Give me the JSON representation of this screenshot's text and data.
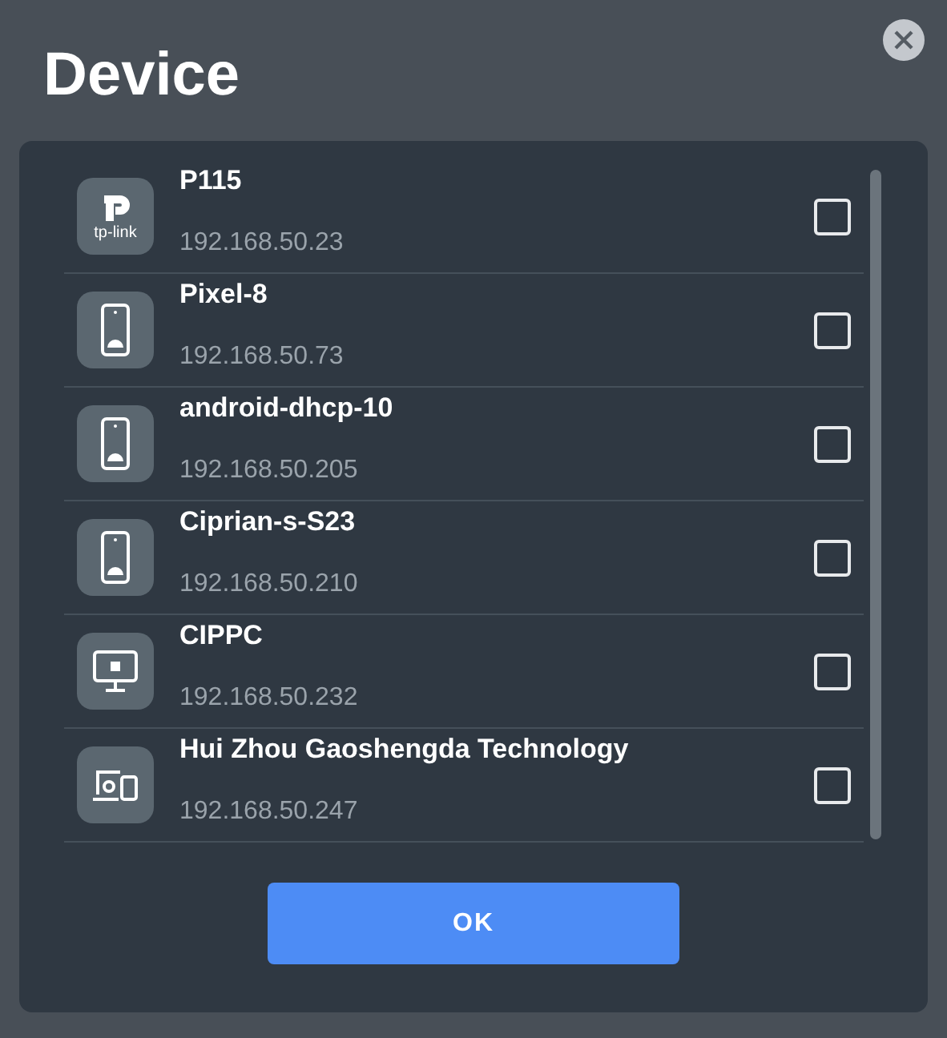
{
  "title": "Device",
  "devices": [
    {
      "kind": "tplink",
      "logo_text": "tp-link",
      "name": "P115",
      "ip": "192.168.50.23",
      "checked": false
    },
    {
      "kind": "phone",
      "name": "Pixel-8",
      "ip": "192.168.50.73",
      "checked": false
    },
    {
      "kind": "phone",
      "name": "android-dhcp-10",
      "ip": "192.168.50.205",
      "checked": false
    },
    {
      "kind": "phone",
      "name": "Ciprian-s-S23",
      "ip": "192.168.50.210",
      "checked": false
    },
    {
      "kind": "pc",
      "name": "CIPPC",
      "ip": "192.168.50.232",
      "checked": false
    },
    {
      "kind": "devices",
      "name": "Hui Zhou Gaoshengda Technology",
      "ip": "192.168.50.247",
      "checked": false
    }
  ],
  "ok_button": "OK"
}
